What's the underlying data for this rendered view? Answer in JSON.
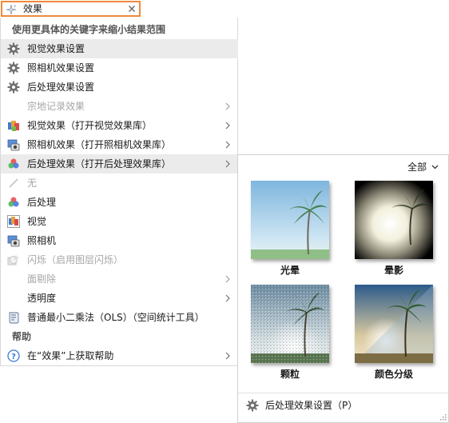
{
  "search": {
    "value": "效果"
  },
  "menu": {
    "header1": "使用更具体的关键字来缩小结果范围",
    "items": [
      {
        "label": "视觉效果设置",
        "icon": "gear-icon",
        "disabled": false,
        "submenu": false
      },
      {
        "label": "照相机效果设置",
        "icon": "gear-icon",
        "disabled": false,
        "submenu": false
      },
      {
        "label": "后处理效果设置",
        "icon": "gear-icon",
        "disabled": false,
        "submenu": false
      },
      {
        "label": "宗地记录效果",
        "icon": "",
        "disabled": true,
        "submenu": true
      },
      {
        "label": "视觉效果（打开视觉效果库）",
        "icon": "visual-effects-library-icon",
        "disabled": false,
        "submenu": true
      },
      {
        "label": "照相机效果（打开照相机效果库）",
        "icon": "camera-effects-library-icon",
        "disabled": false,
        "submenu": true
      },
      {
        "label": "后处理效果（打开后处理效果库）",
        "icon": "post-processing-library-icon",
        "disabled": false,
        "submenu": true
      },
      {
        "label": "无",
        "icon": "none-icon",
        "disabled": true,
        "submenu": false
      },
      {
        "label": "后处理",
        "icon": "post-processing-icon",
        "disabled": false,
        "submenu": false
      },
      {
        "label": "视觉",
        "icon": "visual-icon",
        "disabled": false,
        "submenu": false
      },
      {
        "label": "照相机",
        "icon": "camera-icon",
        "disabled": false,
        "submenu": false
      },
      {
        "label": "闪烁（启用图层闪烁）",
        "icon": "flicker-icon",
        "disabled": true,
        "submenu": false
      },
      {
        "label": "面剔除",
        "icon": "",
        "disabled": true,
        "submenu": true
      },
      {
        "label": "透明度",
        "icon": "",
        "disabled": false,
        "submenu": true
      },
      {
        "label": "普通最小二乘法（OLS）（空间统计工具）",
        "icon": "script-tool-icon",
        "disabled": false,
        "submenu": false
      }
    ],
    "header2": "帮助",
    "help_item": {
      "label": "在“效果”上获取帮助",
      "icon": "help-icon",
      "submenu": true
    }
  },
  "gallery": {
    "filter_label": "全部",
    "thumbs": [
      {
        "label": "光晕"
      },
      {
        "label": "晕影"
      },
      {
        "label": "颗粒"
      },
      {
        "label": "颜色分级"
      }
    ],
    "footer_label": "后处理效果设置（P）"
  }
}
